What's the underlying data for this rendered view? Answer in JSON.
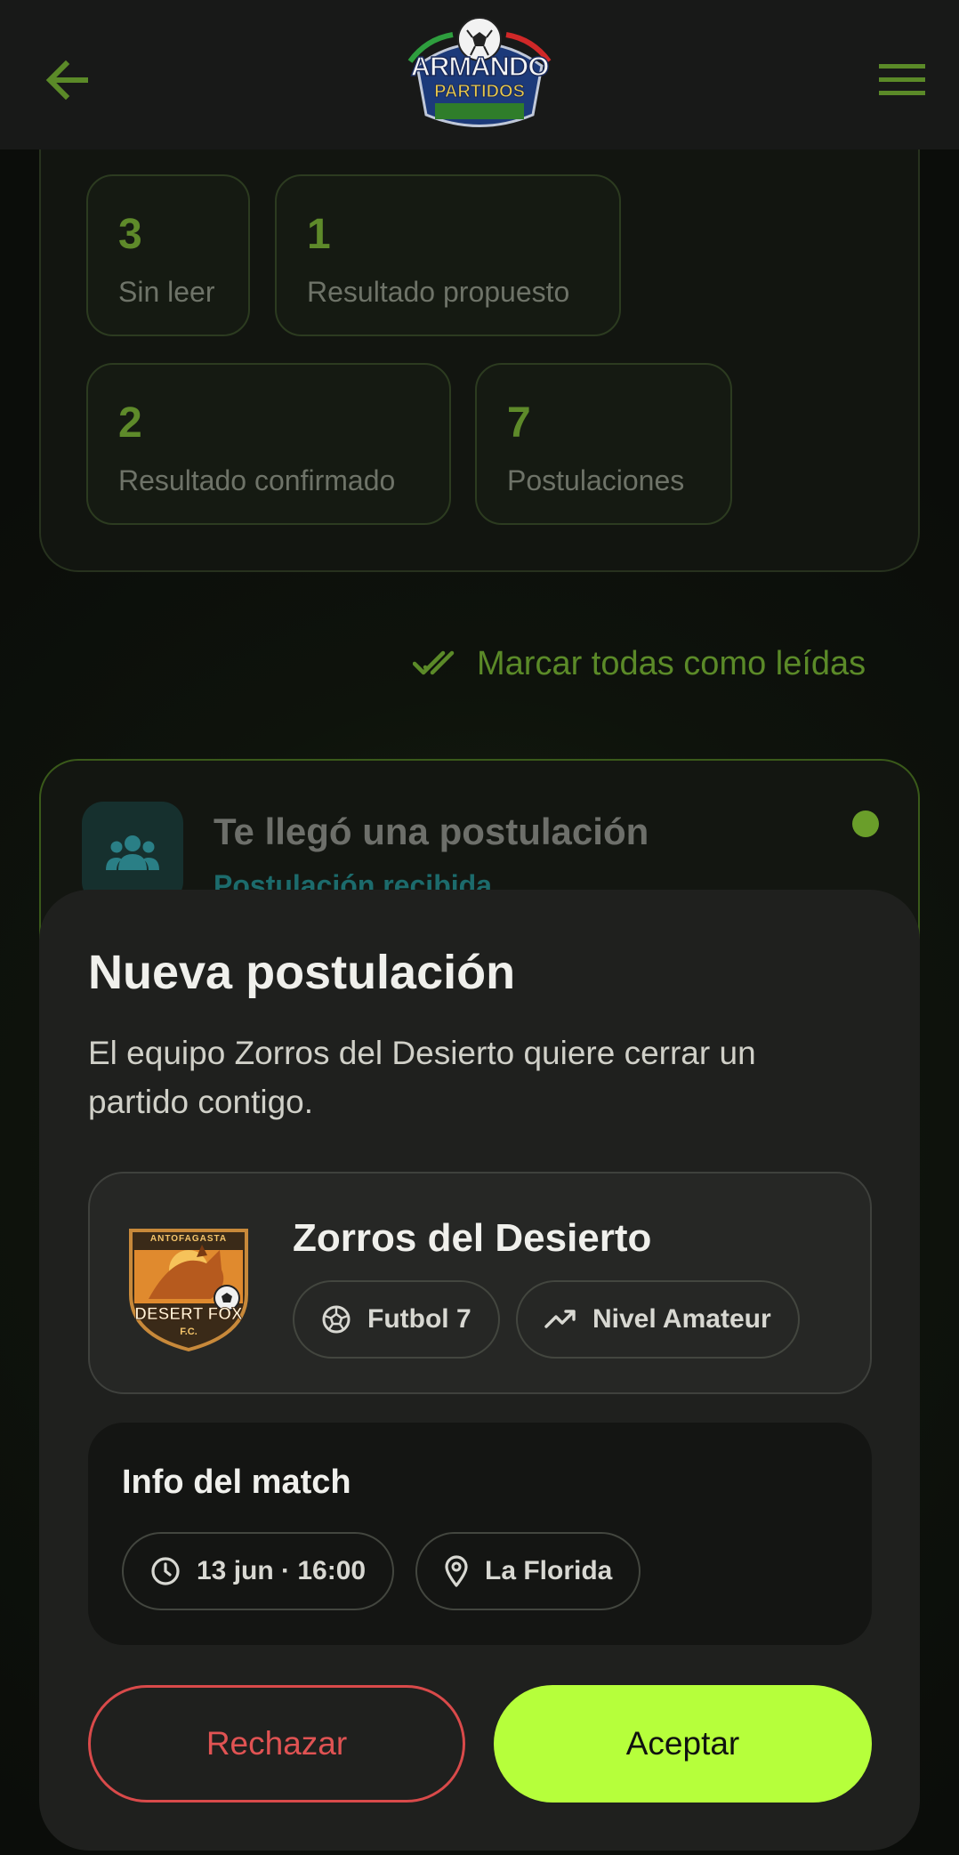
{
  "header": {
    "back_icon": "arrow-left-icon",
    "menu_icon": "hamburger-menu-icon",
    "logo": {
      "line1": "ARMANDO",
      "line2": "PARTIDOS"
    }
  },
  "summary": {
    "stats": [
      {
        "value": "3",
        "label": "Sin leer"
      },
      {
        "value": "1",
        "label": "Resultado propuesto"
      },
      {
        "value": "2",
        "label": "Resultado confirmado"
      },
      {
        "value": "7",
        "label": "Postulaciones"
      }
    ]
  },
  "mark_all": {
    "label": "Marcar todas como leídas",
    "icon": "double-check-icon"
  },
  "notification": {
    "title": "Te llegó una postulación",
    "subtitle": "Postulación recibida",
    "icon": "users-group-icon"
  },
  "sheet": {
    "title": "Nueva postulación",
    "description": "El equipo Zorros del Desierto quiere cerrar un partido contigo.",
    "team": {
      "name": "Zorros del Desierto",
      "logo_text": {
        "top": "ANTOFAGASTA",
        "main": "DESERT FOX",
        "bottom": "F.C."
      },
      "format": "Futbol 7",
      "level": "Nivel Amateur"
    },
    "match_info": {
      "title": "Info del match",
      "datetime": "13 jun · 16:00",
      "location": "La Florida"
    },
    "reject_label": "Rechazar",
    "accept_label": "Aceptar"
  },
  "colors": {
    "accent": "#b6ff3b",
    "green_text": "#5b8a28",
    "reject": "#e05353",
    "sheet_bg": "#1f201e"
  }
}
